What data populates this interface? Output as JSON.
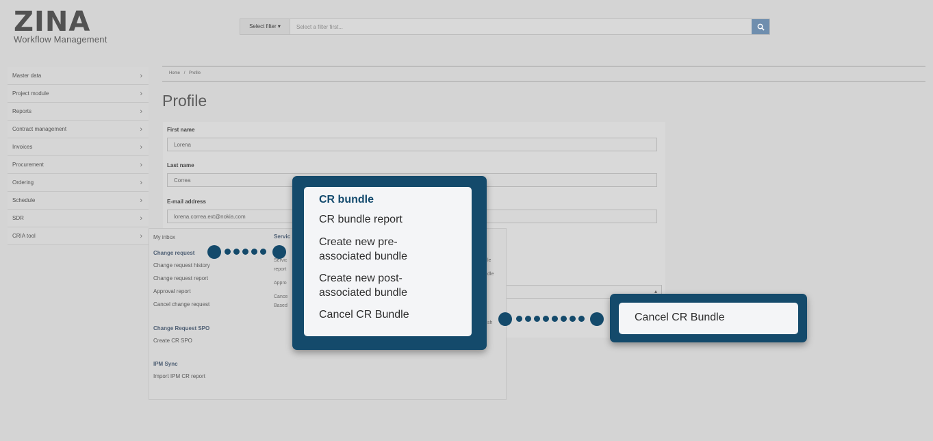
{
  "brand": {
    "name": "ZINA",
    "subtitle": "Workflow Management"
  },
  "search": {
    "filter_label": "Select filter ▾",
    "placeholder": "Select a filter first...",
    "button_icon": "search-icon"
  },
  "sidebar": {
    "items": [
      {
        "label": "Master data"
      },
      {
        "label": "Project module"
      },
      {
        "label": "Reports"
      },
      {
        "label": "Contract management"
      },
      {
        "label": "Invoices"
      },
      {
        "label": "Procurement"
      },
      {
        "label": "Ordering"
      },
      {
        "label": "Schedule"
      },
      {
        "label": "SDR"
      },
      {
        "label": "CRIA tool"
      }
    ],
    "chevron": "›"
  },
  "breadcrumb": {
    "home": "Home",
    "separator": "/",
    "current": "Profile"
  },
  "page": {
    "title": "Profile"
  },
  "form": {
    "first_name_label": "First name",
    "first_name_value": "Lorena",
    "last_name_label": "Last name",
    "last_name_value": "Correa",
    "email_label": "E-mail address",
    "email_value": "lorena.correa.ext@nokia.com"
  },
  "submenu": {
    "col1": {
      "my_inbox": "My inbox",
      "change_request_head": "Change request",
      "items": [
        "Change request history",
        "Change request report",
        "Approval report",
        "Cancel change request"
      ],
      "spo_head": "Change Request SPO",
      "spo_items": [
        "Create CR SPO"
      ],
      "ipm_head": "IPM Sync",
      "ipm_items": [
        "Import IPM CR report"
      ]
    },
    "col2": {
      "head": "Servic",
      "frag1": "Servic",
      "frag2": "report",
      "frag3": "Appro",
      "frag4": "Cance",
      "frag5": "Based",
      "right1": "le",
      "right2": "dle",
      "right3": "sh"
    }
  },
  "callout_bundle": {
    "title": "CR bundle",
    "items": [
      "CR bundle report",
      "Create new pre-associated bundle",
      "Create new post-associated bundle",
      "Cancel CR Bundle"
    ]
  },
  "callout_cancel": {
    "label": "Cancel CR Bundle"
  },
  "colors": {
    "callout": "#144a6b",
    "background": "#d4d4d4",
    "search_button": "#6f8eae"
  }
}
